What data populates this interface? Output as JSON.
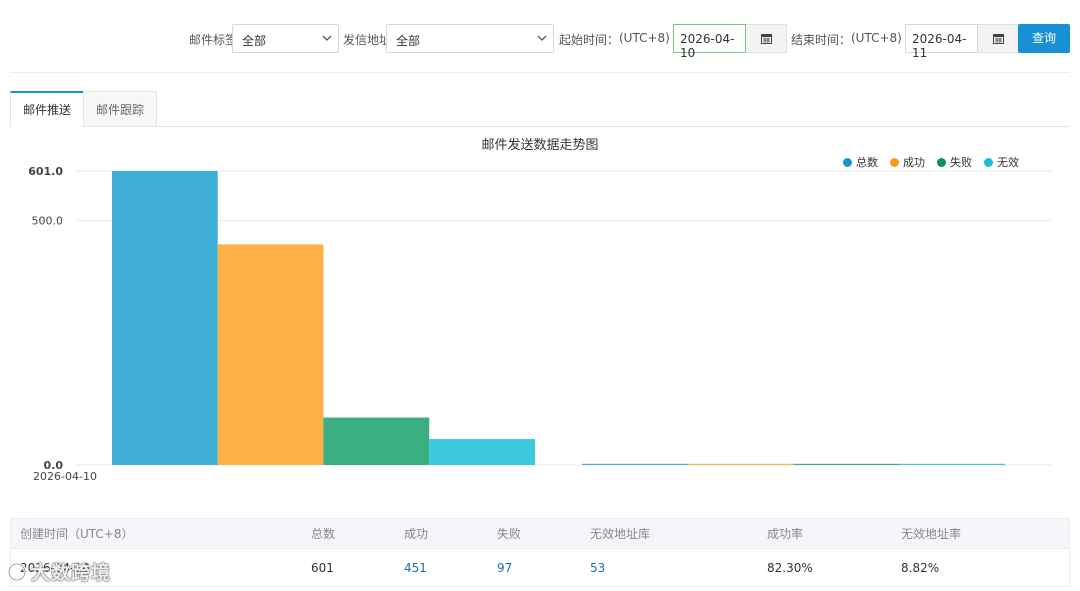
{
  "filters": {
    "tag_label": "邮件标签",
    "tag_value": "全部",
    "sender_label": "发信地址",
    "sender_value": "全部",
    "start_label": "起始时间：",
    "start_tz": "(UTC+8)",
    "start_date": "2026-04-10",
    "end_label": "结束时间：",
    "end_tz": "(UTC+8)",
    "end_date": "2026-04-11",
    "query_label": "查询"
  },
  "tabs": [
    {
      "label": "邮件推送",
      "active": true
    },
    {
      "label": "邮件跟踪",
      "active": false
    }
  ],
  "chart_data": {
    "type": "bar",
    "title": "邮件发送数据走势图",
    "categories": [
      "2026-04-10",
      ""
    ],
    "series": [
      {
        "name": "总数",
        "color": "#2ea7d6",
        "values": [
          601,
          0
        ]
      },
      {
        "name": "成功",
        "color": "#fea93a",
        "values": [
          451,
          0
        ]
      },
      {
        "name": "失败",
        "color": "#2aa876",
        "values": [
          97,
          0
        ]
      },
      {
        "name": "无效",
        "color": "#2cc4d8",
        "values": [
          53,
          0
        ]
      }
    ],
    "yticks": [
      "601.0",
      "500.0",
      "0.0"
    ],
    "ylim": [
      0,
      601
    ],
    "legend_position": "top-right",
    "grid": true
  },
  "table": {
    "headers": [
      "创建时间（UTC+8）",
      "总数",
      "成功",
      "失败",
      "无效地址库",
      "成功率",
      "无效地址率"
    ],
    "rows": [
      [
        "2026-04-10",
        "601",
        "451",
        "97",
        "53",
        "82.30%",
        "8.82%"
      ]
    ]
  },
  "watermark": {
    "text": "大数跨境"
  },
  "icons": {
    "calendar": "calendar-icon",
    "chevron": "chevron-down-icon"
  }
}
